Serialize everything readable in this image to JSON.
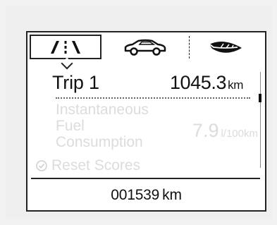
{
  "tabs": [
    {
      "icon": "road-icon",
      "selected": true
    },
    {
      "icon": "car-icon",
      "selected": false
    },
    {
      "icon": "eco-leaf-icon",
      "selected": false
    }
  ],
  "trip": {
    "label": "Trip 1",
    "value": "1045.3",
    "unit": "km"
  },
  "instantaneous": {
    "line1": "Instantaneous",
    "line2": "Fuel",
    "line3": "Consumption",
    "value": "7.9",
    "unit": "l/100km"
  },
  "reset": {
    "label": "Reset Scores",
    "icon": "check-circle-icon"
  },
  "odometer": {
    "value": "001539",
    "unit": "km"
  },
  "colors": {
    "active": "#111111",
    "inactive": "#dcdcdc",
    "background": "#ffffff"
  }
}
